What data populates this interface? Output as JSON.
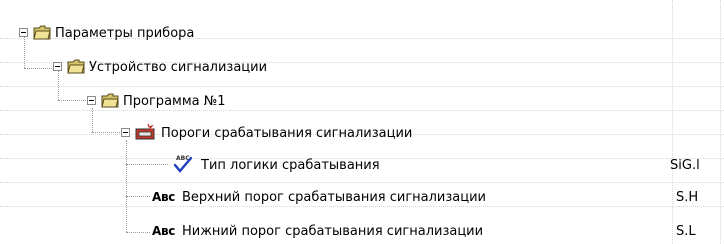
{
  "tree": {
    "items": [
      {
        "label": "Параметры прибора",
        "icon": "folder-icon"
      },
      {
        "label": "Устройство сигнализации",
        "icon": "folder-icon"
      },
      {
        "label": "Программа  №1",
        "icon": "folder-icon"
      },
      {
        "label": "Пороги срабатывания сигнализации",
        "icon": "alarm-icon"
      },
      {
        "label": "Тип логики срабатывания",
        "icon": "abc-check-icon",
        "value": "SiG.l"
      },
      {
        "label": "Верхний порог срабатывания сигнализации",
        "icon": "abc-icon",
        "icon_text": "Авс",
        "value": "S.H"
      },
      {
        "label": "Нижний порог срабатывания сигнализации",
        "icon": "abc-icon",
        "icon_text": "Авс",
        "value": "S.L"
      }
    ]
  }
}
